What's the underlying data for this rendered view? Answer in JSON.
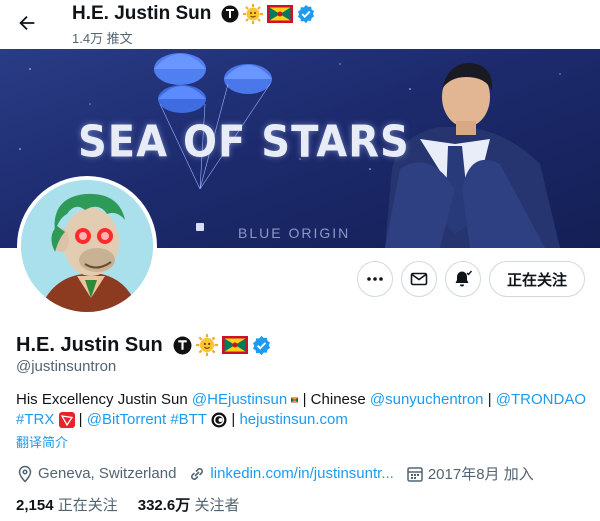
{
  "header": {
    "back_label": "←",
    "name": "H.E. Justin Sun",
    "tweet_count": "1.4万 推文"
  },
  "banner": {
    "title": "SEA OF STARS",
    "brand": "BLUE ORIGIN"
  },
  "actions": {
    "follow_label": "正在关注"
  },
  "profile": {
    "name": "H.E. Justin Sun",
    "handle": "@justinsuntron",
    "bio": {
      "prefix": "His Excellency Justin Sun",
      "mention1": "@HEjustinsun",
      "mid1": " | Chinese ",
      "mention2": "@sunyuchentron",
      "sep1": " | ",
      "mention3": "@TRONDAO",
      "hashtag1": "#TRX",
      "sep2": " | ",
      "mention4": "@BitTorrent",
      "hashtag2": "#BTT",
      "sep3": " | ",
      "website": "hejustinsun.com"
    },
    "translate_label": "翻译简介",
    "location": "Geneva, Switzerland",
    "link": "linkedin.com/in/justinsuntr...",
    "joined": "2017年8月 加入",
    "following_count": "2,154",
    "following_label": "正在关注",
    "followers_count": "332.6万",
    "followers_label": "关注者"
  },
  "colors": {
    "accent": "#1d9bf0",
    "text": "#0f1419",
    "muted": "#536471",
    "border": "#cfd9de",
    "banner": "#1d2b6e"
  },
  "icons": {
    "back": "arrow-left-icon",
    "more": "more-dots-icon",
    "message": "envelope-icon",
    "notify": "bell-plus-icon",
    "verified": "verified-badge-icon",
    "location": "location-pin-icon",
    "link": "link-icon",
    "calendar": "calendar-icon"
  }
}
